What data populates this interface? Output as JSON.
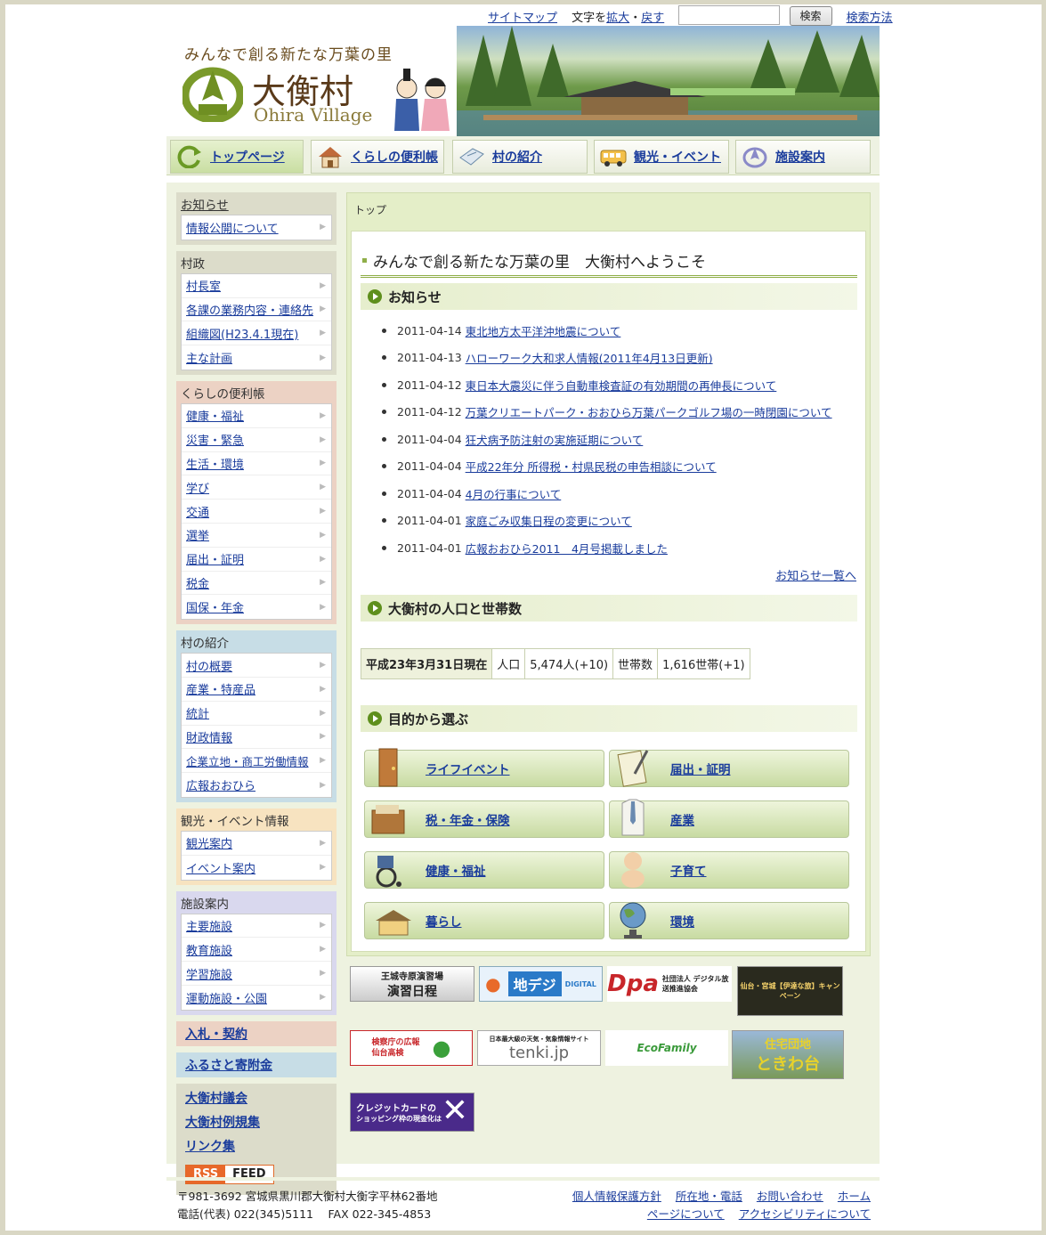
{
  "util": {
    "sitemap": "サイトマップ",
    "textsize_label": "文字を",
    "enlarge": "拡大",
    "sep": "・",
    "restore": "戻す",
    "search_placeholder": "",
    "search_button": "検索",
    "search_help": "検索方法"
  },
  "header": {
    "tagline": "みんなで創る新たな万葉の里",
    "village_name": "大衡村",
    "village_name_en": "Ohira Village"
  },
  "gnav": [
    {
      "label": "トップページ"
    },
    {
      "label": "くらしの便利帳"
    },
    {
      "label": "村の紹介"
    },
    {
      "label": "観光・イベント"
    },
    {
      "label": "施設案内"
    }
  ],
  "sidebar": {
    "notice": {
      "title": "お知らせ",
      "items": [
        "情報公開について"
      ]
    },
    "gov": {
      "title": "村政",
      "items": [
        "村長室",
        "各課の業務内容・連絡先",
        "組織図(H23.4.1現在)",
        "主な計画"
      ]
    },
    "life": {
      "title": "くらしの便利帳",
      "items": [
        "健康・福祉",
        "災害・緊急",
        "生活・環境",
        "学び",
        "交通",
        "選挙",
        "届出・証明",
        "税金",
        "国保・年金"
      ]
    },
    "intro": {
      "title": "村の紹介",
      "items": [
        "村の概要",
        "産業・特産品",
        "統計",
        "財政情報",
        "企業立地・商工労働情報",
        "広報おおひら"
      ]
    },
    "tour": {
      "title": "観光・イベント情報",
      "items": [
        "観光案内",
        "イベント案内"
      ]
    },
    "facility": {
      "title": "施設案内",
      "items": [
        "主要施設",
        "教育施設",
        "学習施設",
        "運動施設・公園"
      ]
    },
    "bid": "入札・契約",
    "furusato": "ふるさと寄附金",
    "assembly": "大衡村議会",
    "rules": "大衡村例規集",
    "links": "リンク集",
    "rss": "RSS",
    "feed": "FEED"
  },
  "main": {
    "breadcrumb": "トップ",
    "welcome": "みんなで創る新たな万葉の里　大衡村へようこそ",
    "news_title": "お知らせ",
    "news": [
      {
        "date": "2011-04-14",
        "title": "東北地方太平洋沖地震について"
      },
      {
        "date": "2011-04-13",
        "title": "ハローワーク大和求人情報(2011年4月13日更新)"
      },
      {
        "date": "2011-04-12",
        "title": "東日本大震災に伴う自動車検査証の有効期間の再伸長について"
      },
      {
        "date": "2011-04-12",
        "title": "万葉クリエートパーク・おおひら万葉パークゴルフ場の一時閉園について"
      },
      {
        "date": "2011-04-04",
        "title": "狂犬病予防注射の実施延期について"
      },
      {
        "date": "2011-04-04",
        "title": "平成22年分 所得税・村県民税の申告相談について"
      },
      {
        "date": "2011-04-04",
        "title": "4月の行事について"
      },
      {
        "date": "2011-04-01",
        "title": "家庭ごみ収集日程の変更について"
      },
      {
        "date": "2011-04-01",
        "title": "広報おおひら2011　4月号掲載しました"
      }
    ],
    "news_more": "お知らせ一覧へ",
    "pop_title": "大衡村の人口と世帯数",
    "pop": {
      "date": "平成23年3月31日現在",
      "pop_label": "人口",
      "pop_value": "5,474人(+10)",
      "house_label": "世帯数",
      "house_value": "1,616世帯(+1)"
    },
    "purpose_title": "目的から選ぶ",
    "purposes": [
      "ライフイベント",
      "届出・証明",
      "税・年金・保険",
      "産業",
      "健康・福祉",
      "子育て",
      "暮らし",
      "環境"
    ]
  },
  "banners": [
    {
      "line1": "王城寺原演習場",
      "line2": "演習日程"
    },
    {
      "line1": "地デジ",
      "line2": "DIGITAL"
    },
    {
      "line1": "Dpa",
      "line2": "社団法人 デジタル放送推進協会"
    },
    {
      "line1": "仙台・宮城【伊達な旅】キャンペーン",
      "line2": ""
    },
    {
      "line1": "検察庁の広報",
      "line2": "仙台高検"
    },
    {
      "line1": "日本最大級の天気・気象情報サイト",
      "line2": "tenki.jp"
    },
    {
      "line1": "EcoFamily",
      "line2": ""
    },
    {
      "line1": "住宅団地",
      "line2": "ときわ台"
    },
    {
      "line1": "クレジットカードの",
      "line2": "ショッピング枠の現金化は"
    }
  ],
  "footer": {
    "address": "〒981-3692  宮城県黒川郡大衡村大衡字平林62番地",
    "tel": "電話(代表) 022(345)5111　 FAX  022-345-4853",
    "links1": [
      "個人情報保護方針",
      "所在地・電話",
      "お問い合わせ",
      "ホーム"
    ],
    "links2": [
      "ページについて",
      "アクセシビリティについて"
    ]
  },
  "colors": {
    "accent": "#5e8f1c",
    "link": "#1a3c9c",
    "bg": "#d9d7c4"
  }
}
